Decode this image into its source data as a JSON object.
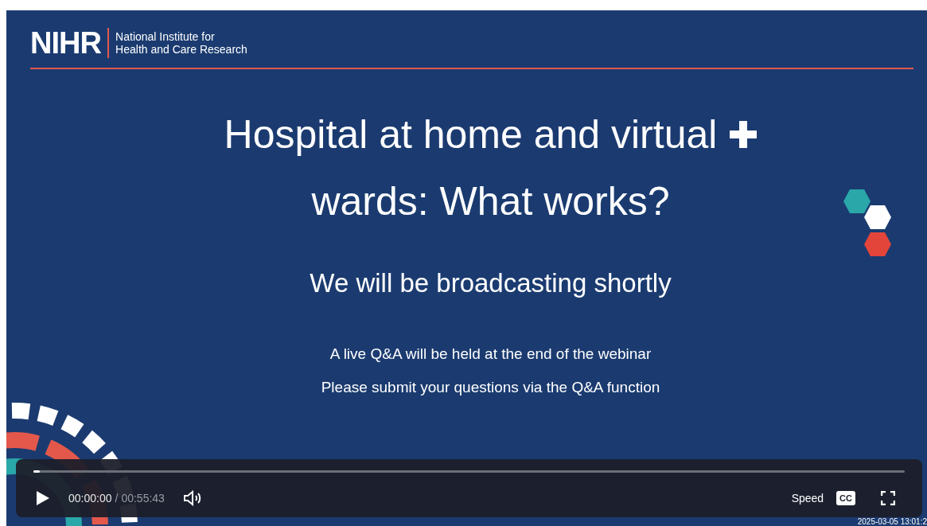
{
  "slide": {
    "logo": {
      "acronym": "NIHR",
      "name_line_1": "National Institute for",
      "name_line_2": "Health and Care Research"
    },
    "title_line_1": "Hospital at home and virtual",
    "title_line_2": "wards: What works?",
    "subtitle": "We will be broadcasting shortly",
    "notes": [
      "A live Q&A will be held at the end of the webinar",
      "Please submit your questions via the Q&A function"
    ]
  },
  "player": {
    "progress": {
      "level": 0
    },
    "current_time": "00:00:00",
    "separator": "/",
    "duration": "00:55:43",
    "speed_label": "Speed",
    "captions_label": "CC"
  },
  "timestamp": "2025-03-05 13:01:2"
}
